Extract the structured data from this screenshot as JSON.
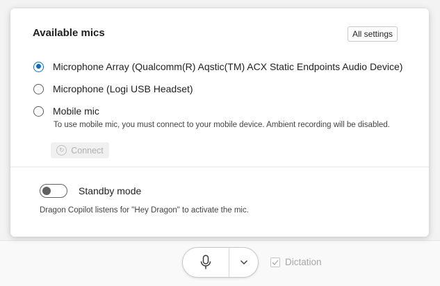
{
  "panel": {
    "title": "Available mics",
    "all_settings_label": "All settings",
    "mics": [
      {
        "label": "Microphone Array (Qualcomm(R) Aqstic(TM) ACX Static Endpoints Audio Device)",
        "selected": true
      },
      {
        "label": "Microphone (Logi USB Headset)",
        "selected": false
      },
      {
        "label": "Mobile mic",
        "selected": false
      }
    ],
    "mobile_hint": "To use mobile mic, you must connect to your mobile device. Ambient recording will be disabled.",
    "connect_label": "Connect",
    "standby": {
      "label": "Standby mode",
      "enabled": false,
      "description": "Dragon Copilot listens for \"Hey Dragon\" to activate the mic."
    }
  },
  "bottom_bar": {
    "dictation_label": "Dictation",
    "dictation_checked": true
  },
  "colors": {
    "accent": "#0f6cbd",
    "disabled_text": "#a6a6a6"
  },
  "icons": [
    "refresh-icon",
    "microphone-icon",
    "chevron-down-icon",
    "checkmark-icon"
  ]
}
